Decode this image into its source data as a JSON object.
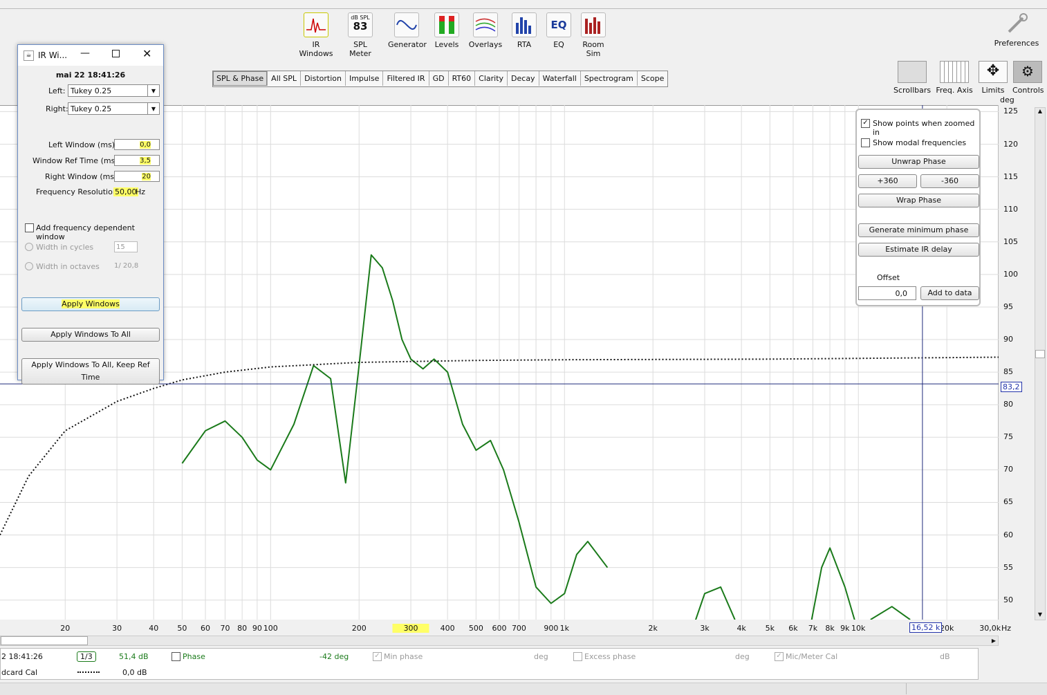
{
  "toolbar": {
    "items": [
      {
        "label": "IR Windows",
        "icon": "ir-windows-icon"
      },
      {
        "label": "SPL Meter",
        "icon": "spl-meter-icon",
        "meter_unit": "dB SPL",
        "meter_value": "83"
      },
      {
        "label": "Generator",
        "icon": "generator-icon"
      },
      {
        "label": "Levels",
        "icon": "levels-icon"
      },
      {
        "label": "Overlays",
        "icon": "overlays-icon"
      },
      {
        "label": "RTA",
        "icon": "rta-icon"
      },
      {
        "label": "EQ",
        "icon": "eq-icon",
        "icon_text": "EQ"
      },
      {
        "label": "Room Sim",
        "icon": "room-sim-icon"
      }
    ],
    "preferences": "Preferences"
  },
  "tabs": [
    "SPL & Phase",
    "All SPL",
    "Distortion",
    "Impulse",
    "Filtered IR",
    "GD",
    "RT60",
    "Clarity",
    "Decay",
    "Waterfall",
    "Spectrogram",
    "Scope"
  ],
  "active_tab": "SPL & Phase",
  "right_tools": [
    "Scrollbars",
    "Freq. Axis",
    "Limits",
    "Controls"
  ],
  "ir_dialog": {
    "title": "IR Wi...",
    "timestamp": "mai 22 18:41:26",
    "left_label": "Left:",
    "left_value": "Tukey 0.25",
    "right_label": "Right:",
    "right_value": "Tukey 0.25",
    "left_window_label": "Left Window (ms):",
    "left_window_value": "0,0",
    "ref_time_label": "Window Ref Time (ms):",
    "ref_time_value": "3,5",
    "right_window_label": "Right Window (ms):",
    "right_window_value": "20",
    "freq_res_label": "Frequency Resolution:",
    "freq_res_value": "50,00",
    "freq_res_unit": "Hz",
    "fdw_label": "Add frequency dependent window",
    "cycles_label": "Width in cycles",
    "cycles_value": "15",
    "octaves_label": "Width in octaves",
    "octaves_value": "1/ 20,8",
    "apply": "Apply Windows",
    "apply_all": "Apply Windows To All",
    "apply_all_keep": "Apply Windows To All, Keep Ref Time"
  },
  "controls": {
    "show_points": "Show points when zoomed in",
    "show_modal": "Show modal frequencies",
    "unwrap": "Unwrap Phase",
    "plus360": "+360",
    "minus360": "-360",
    "wrap": "Wrap Phase",
    "gen_min": "Generate minimum phase",
    "est_ir": "Estimate IR delay",
    "offset_label": "Offset",
    "offset_value": "0,0",
    "add_to_data": "Add to data"
  },
  "chart_data": {
    "type": "line",
    "y_unit": "deg",
    "x_unit": "Hz",
    "yticks": [
      "125",
      "120",
      "115",
      "110",
      "105",
      "100",
      "95",
      "90",
      "85",
      "80",
      "75",
      "70",
      "65",
      "60",
      "55",
      "50"
    ],
    "xticks": [
      "20",
      "30",
      "40",
      "50",
      "60",
      "70",
      "80",
      "90",
      "100",
      "200",
      "300",
      "400",
      "500",
      "600",
      "700",
      "900",
      "1k",
      "2k",
      "3k",
      "4k",
      "5k",
      "6k",
      "7k",
      "8k",
      "9k",
      "10k",
      "20k",
      "30,0k"
    ],
    "cursor_y_label": "83,2",
    "cursor_x_label": "16,52 k",
    "ylim": [
      47,
      126
    ],
    "xlim": [
      12,
      30000
    ],
    "series": [
      {
        "color": "#1a7a1a",
        "x": [
          50,
          60,
          70,
          80,
          90,
          100,
          120,
          140,
          160,
          180,
          200,
          220,
          240,
          260,
          280,
          300,
          330,
          360,
          400,
          450,
          500,
          560,
          620,
          700,
          800,
          900,
          1000,
          1100,
          1200,
          1400
        ],
        "y": [
          71,
          76,
          77.5,
          75,
          71.5,
          70,
          77,
          86,
          84,
          68,
          86,
          103,
          101,
          96,
          90,
          87,
          85.5,
          87,
          85,
          77,
          73,
          74.5,
          70,
          62,
          52,
          49.5,
          51,
          57,
          59,
          55
        ]
      },
      {
        "color": "#1a7a1a",
        "x": [
          2700,
          3000,
          3400,
          3800
        ],
        "y": [
          45,
          51,
          52,
          47
        ]
      },
      {
        "color": "#1a7a1a",
        "x": [
          6800,
          7500,
          8000,
          9000,
          10000
        ],
        "y": [
          45,
          55,
          58,
          52,
          45
        ]
      },
      {
        "color": "#1a7a1a",
        "x": [
          11000,
          13000,
          15000
        ],
        "y": [
          47,
          49,
          47
        ]
      },
      {
        "color": "#111111",
        "dashed": true,
        "x": [
          12,
          15,
          20,
          30,
          40,
          50,
          70,
          100,
          200,
          500,
          1000,
          5000,
          30000
        ],
        "y": [
          60,
          69,
          76,
          80.5,
          82.5,
          83.8,
          85,
          85.8,
          86.5,
          86.8,
          86.9,
          87,
          87.3
        ]
      }
    ]
  },
  "status_bar": {
    "meas_name": "2 18:41:26",
    "smoothing": "1/3",
    "spl_value": "51,4 dB",
    "phase_label": "Phase",
    "phase_value": "-42 deg",
    "min_phase_label": "Min phase",
    "min_phase_unit": "deg",
    "excess_phase_label": "Excess phase",
    "excess_phase_unit": "deg",
    "mic_cal_label": "Mic/Meter Cal",
    "mic_cal_unit": "dB",
    "cal_name": "dcard Cal",
    "cal_value": "0,0 dB"
  }
}
